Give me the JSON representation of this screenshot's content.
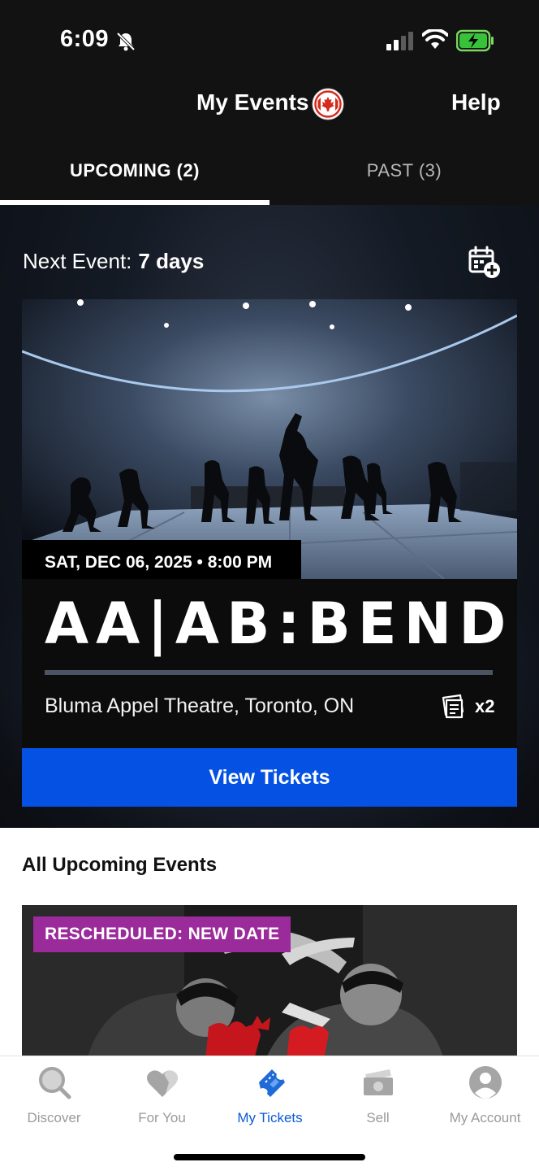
{
  "status_bar": {
    "time": "6:09",
    "icons": [
      "bell-slash-icon",
      "signal-icon",
      "wifi-icon",
      "battery-charging-icon"
    ]
  },
  "header": {
    "title": "My Events",
    "flag_icon": "canada-flag-icon",
    "help_label": "Help"
  },
  "tabs": [
    {
      "label": "UPCOMING (2)",
      "active": true
    },
    {
      "label": "PAST (3)",
      "active": false
    }
  ],
  "next_event": {
    "label": "Next Event:",
    "value": "7 days",
    "calendar_icon": "calendar-add-icon"
  },
  "featured_event": {
    "date": "SAT, DEC 06, 2025 • 8:00 PM",
    "title": "AA|AB:BEND",
    "venue": "Bluma Appel Theatre, Toronto, ON",
    "ticket_icon": "tickets-icon",
    "ticket_count": "x2",
    "cta_label": "View Tickets"
  },
  "upcoming_section": {
    "title": "All Upcoming Events",
    "items": [
      {
        "badge": "RESCHEDULED: NEW DATE"
      }
    ]
  },
  "nav": [
    {
      "label": "Discover",
      "icon": "search-icon",
      "active": false
    },
    {
      "label": "For You",
      "icon": "heart-icon",
      "active": false
    },
    {
      "label": "My Tickets",
      "icon": "ticket-icon",
      "active": true
    },
    {
      "label": "Sell",
      "icon": "cash-icon",
      "active": false
    },
    {
      "label": "My Account",
      "icon": "account-icon",
      "active": false
    }
  ],
  "colors": {
    "cta_blue": "#0451e4",
    "badge_purple": "#9b2a9b",
    "active_nav": "#0b5bd6",
    "inactive_nav": "#9a9a9a"
  }
}
